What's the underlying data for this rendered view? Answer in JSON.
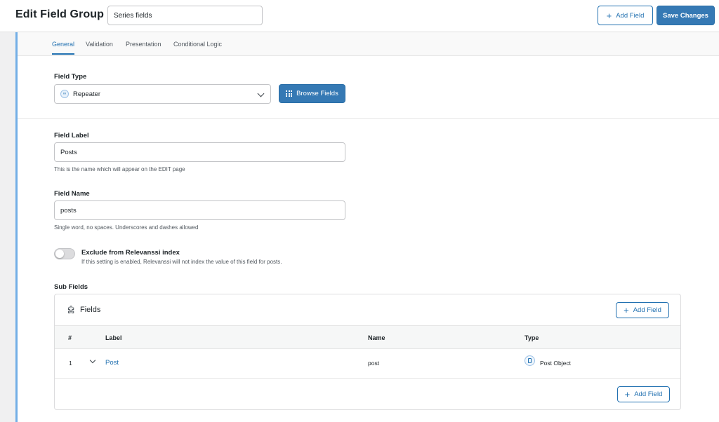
{
  "header": {
    "title": "Edit Field Group",
    "group_name_value": "Series fields",
    "add_field_label": "Add Field",
    "save_label": "Save Changes"
  },
  "tabs": [
    {
      "label": "General",
      "active": true
    },
    {
      "label": "Validation",
      "active": false
    },
    {
      "label": "Presentation",
      "active": false
    },
    {
      "label": "Conditional Logic",
      "active": false
    }
  ],
  "field_type": {
    "label": "Field Type",
    "selected": "Repeater",
    "browse_label": "Browse Fields"
  },
  "field_label": {
    "label": "Field Label",
    "value": "Posts",
    "help": "This is the name which will appear on the EDIT page"
  },
  "field_name": {
    "label": "Field Name",
    "value": "posts",
    "help": "Single word, no spaces. Underscores and dashes allowed"
  },
  "relevanssi": {
    "label": "Exclude from Relevanssi index",
    "help": "If this setting is enabled, Relevanssi will not index the value of this field for posts.",
    "enabled": false
  },
  "sub_fields": {
    "section_label": "Sub Fields",
    "title": "Fields",
    "add_field_label": "Add Field",
    "columns": [
      "#",
      "Label",
      "Name",
      "Type"
    ],
    "rows": [
      {
        "num": "1",
        "label": "Post",
        "name": "post",
        "type": "Post Object"
      }
    ]
  },
  "colors": {
    "accent": "#2271b1",
    "primary_button": "#3579b4",
    "panel_border": "#72aee6"
  },
  "icons": [
    "plus-icon",
    "repeater-icon",
    "chevron-down-icon",
    "grid-icon",
    "puzzle-icon",
    "post-object-icon"
  ]
}
